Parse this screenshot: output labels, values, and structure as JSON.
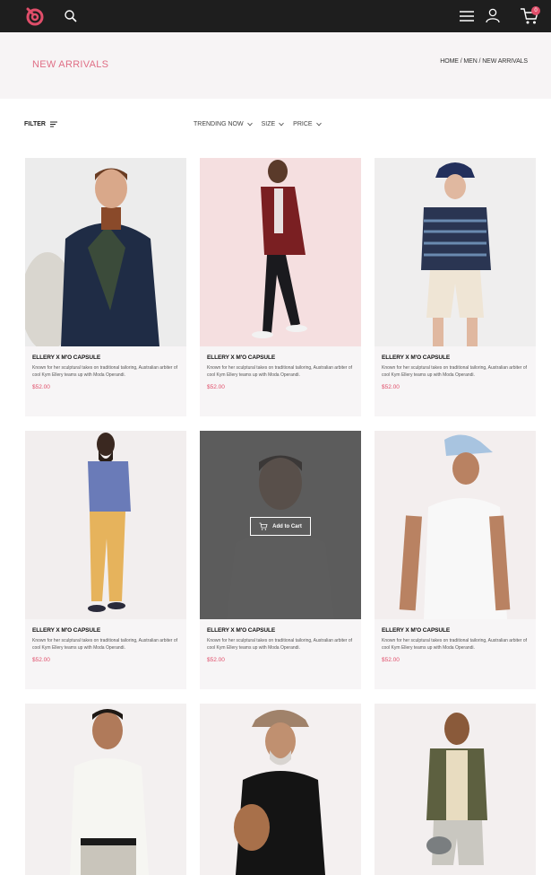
{
  "header": {
    "icons": [
      "logo-icon",
      "search-icon",
      "menu-icon",
      "user-icon",
      "cart-icon"
    ],
    "cart_count": "0"
  },
  "page": {
    "title": "NEW ARRIVALS",
    "breadcrumb": "HOME / MEN / NEW ARRIVALS"
  },
  "filters": {
    "filter_label": "FILTER",
    "sort": [
      "TRENDING NOW",
      "SIZE",
      "PRICE"
    ]
  },
  "products": [
    {
      "title": "ELLERY X M'O CAPSULE",
      "desc": "Known for her sculptural takes on traditional tailoring, Australian arbiter of cool Kym Ellery teams up with Moda Operandi.",
      "price": "$52.00",
      "bg": "#ececec"
    },
    {
      "title": "ELLERY X M'O CAPSULE",
      "desc": "Known for her sculptural takes on traditional tailoring, Australian arbiter of cool Kym Ellery teams up with Moda Operandi.",
      "price": "$52.00",
      "bg": "#f5dfe0"
    },
    {
      "title": "ELLERY X M'O CAPSULE",
      "desc": "Known for her sculptural takes on traditional tailoring, Australian arbiter of cool Kym Ellery teams up with Moda Operandi.",
      "price": "$52.00",
      "bg": "#efeeee"
    },
    {
      "title": "ELLERY X M'O CAPSULE",
      "desc": "Known for her sculptural takes on traditional tailoring, Australian arbiter of cool Kym Ellery teams up with Moda Operandi.",
      "price": "$52.00",
      "bg": "#f2eeee"
    },
    {
      "title": "ELLERY X M'O CAPSULE",
      "desc": "Known for her sculptural takes on traditional tailoring, Australian arbiter of cool Kym Ellery teams up with Moda Operandi.",
      "price": "$52.00",
      "bg": "#efeded"
    },
    {
      "title": "ELLERY X M'O CAPSULE",
      "desc": "Known for her sculptural takes on traditional tailoring, Australian arbiter of cool Kym Ellery teams up with Moda Operandi.",
      "price": "$52.00",
      "bg": "#f3eeee"
    },
    {
      "title": "",
      "desc": "",
      "price": "",
      "bg": "#f3f0f0"
    },
    {
      "title": "",
      "desc": "",
      "price": "",
      "bg": "#f4f0f0"
    },
    {
      "title": "",
      "desc": "",
      "price": "",
      "bg": "#f3efef"
    }
  ],
  "overlay": {
    "add_to_cart_label": "Add to Cart"
  },
  "colors": {
    "accent": "#e04e6a",
    "topbar": "#1e1e1e",
    "header_bg": "#f7f4f5"
  }
}
